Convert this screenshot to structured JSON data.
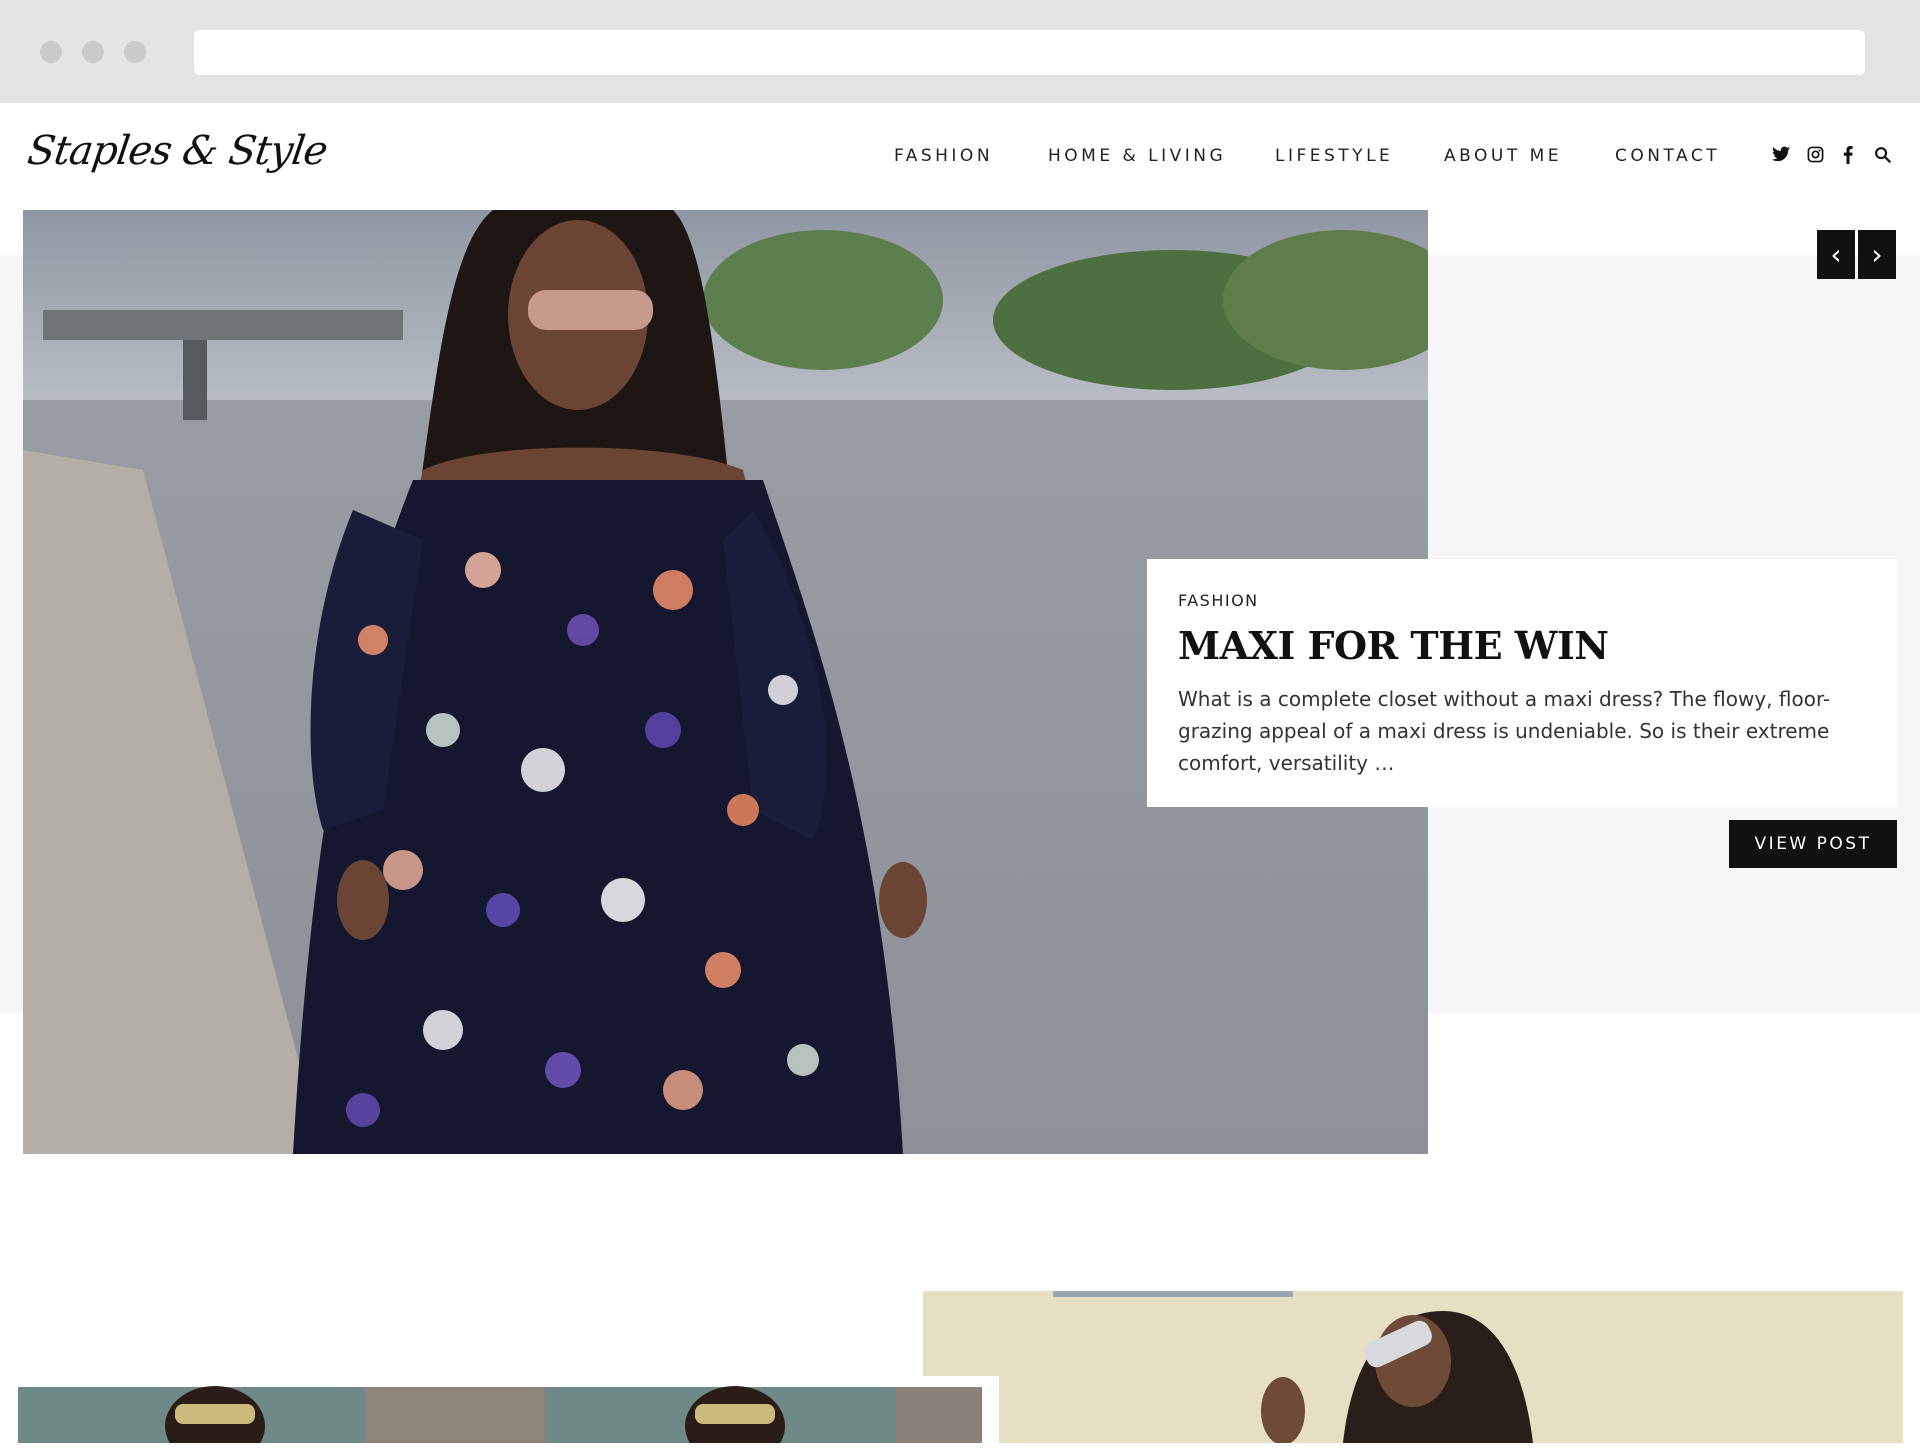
{
  "site": {
    "logo_text": "Staples & Style"
  },
  "nav": {
    "items": [
      {
        "label": "FASHION"
      },
      {
        "label": "HOME & LIVING"
      },
      {
        "label": "LIFESTYLE"
      },
      {
        "label": "ABOUT ME"
      },
      {
        "label": "CONTACT"
      }
    ]
  },
  "social_icons": [
    "twitter-icon",
    "instagram-icon",
    "facebook-icon",
    "search-icon"
  ],
  "slider": {
    "prev_icon": "chevron-left-icon",
    "next_icon": "chevron-right-icon"
  },
  "featured_post": {
    "category": "FASHION",
    "title": "MAXI FOR THE WIN",
    "excerpt": "What is a complete closet without a maxi dress? The flowy, floor-grazing appeal of a maxi dress is undeniable. So is their extreme comfort, versatility …",
    "button_label": "VIEW POST"
  },
  "colors": {
    "accent": "#111111",
    "band": "#f6f6f6",
    "chrome": "#e2e3e5"
  }
}
